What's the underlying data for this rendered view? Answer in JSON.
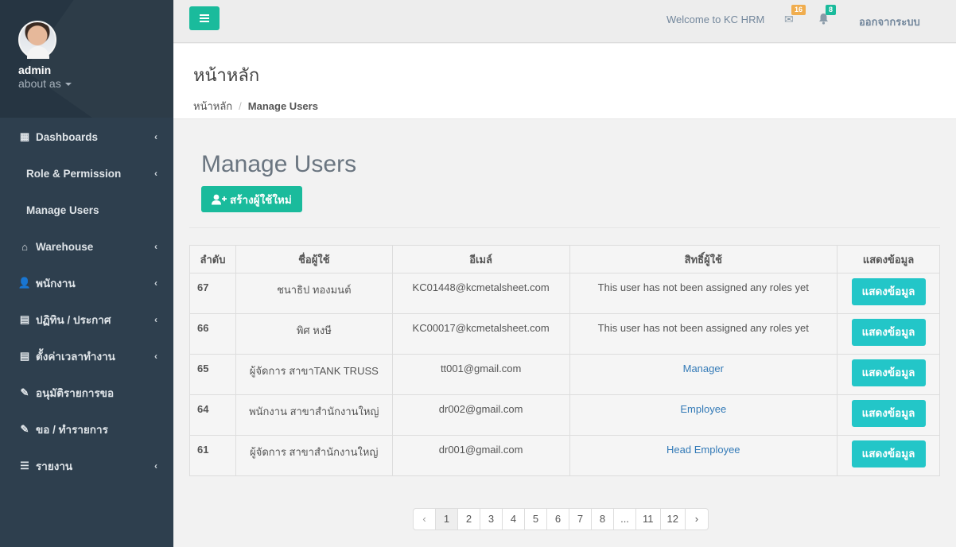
{
  "sidebar": {
    "user": {
      "name": "admin",
      "subtitle": "about as"
    },
    "items": [
      {
        "label": "Dashboards",
        "icon": "dashboard-icon",
        "glyph": "▦",
        "has_children": true
      },
      {
        "label": "Role & Permission",
        "icon": "",
        "glyph": "",
        "has_children": true,
        "sub": true
      },
      {
        "label": "Manage Users",
        "icon": "",
        "glyph": "",
        "has_children": false,
        "sub": true
      },
      {
        "label": "Warehouse",
        "icon": "home-icon",
        "glyph": "⌂",
        "has_children": true
      },
      {
        "label": "พนักงาน",
        "icon": "user-icon",
        "glyph": "👤",
        "has_children": true
      },
      {
        "label": "ปฏิทิน / ประกาศ",
        "icon": "calendar-icon",
        "glyph": "▤",
        "has_children": true
      },
      {
        "label": "ตั้งค่าเวลาทำงาน",
        "icon": "calendar-icon",
        "glyph": "▤",
        "has_children": true
      },
      {
        "label": "อนุมัติรายการขอ",
        "icon": "pencil-icon",
        "glyph": "✎",
        "has_children": false
      },
      {
        "label": "ขอ / ทำรายการ",
        "icon": "pencil-icon",
        "glyph": "✎",
        "has_children": false
      },
      {
        "label": "รายงาน",
        "icon": "list-icon",
        "glyph": "☰",
        "has_children": true
      }
    ]
  },
  "topbar": {
    "welcome": "Welcome to KC HRM",
    "mail_count": "16",
    "notif_count": "8",
    "logout": "ออกจากระบบ",
    "colors": {
      "mail_badge": "#f0ad4e",
      "notif_badge": "#1abb9c"
    }
  },
  "page_header": {
    "title": "หน้าหลัก",
    "breadcrumb": [
      "หน้าหลัก",
      "Manage Users"
    ]
  },
  "main": {
    "title": "Manage Users",
    "create_button": "สร้างผู้ใช้ใหม่",
    "table": {
      "headers": [
        "ลำดับ",
        "ชื่อผู้ใช้",
        "อีเมล์",
        "สิทธิ์ผู้ใช้",
        "แสดงข้อมูล"
      ],
      "rows": [
        {
          "id": "67",
          "name": "ชนาธิป ทองมนต์",
          "email": "KC01448@kcmetalsheet.com",
          "role": "This user has not been assigned any roles yet",
          "role_is_link": false,
          "action": "แสดงข้อมูล"
        },
        {
          "id": "66",
          "name": "พิศ หงษี",
          "email": "KC00017@kcmetalsheet.com",
          "role": "This user has not been assigned any roles yet",
          "role_is_link": false,
          "action": "แสดงข้อมูล"
        },
        {
          "id": "65",
          "name": "ผู้จัดการ สาขาTANK TRUSS",
          "email": "tt001@gmail.com",
          "role": "Manager",
          "role_is_link": true,
          "action": "แสดงข้อมูล"
        },
        {
          "id": "64",
          "name": "พนักงาน สาขาสำนักงานใหญ่",
          "email": "dr002@gmail.com",
          "role": "Employee",
          "role_is_link": true,
          "action": "แสดงข้อมูล"
        },
        {
          "id": "61",
          "name": "ผู้จัดการ สาขาสำนักงานใหญ่",
          "email": "dr001@gmail.com",
          "role": "Head Employee",
          "role_is_link": true,
          "action": "แสดงข้อมูล"
        }
      ]
    },
    "pagination": {
      "prev": "‹",
      "pages": [
        "1",
        "2",
        "3",
        "4",
        "5",
        "6",
        "7",
        "8",
        "...",
        "11",
        "12"
      ],
      "current": "1",
      "next": "›"
    }
  }
}
